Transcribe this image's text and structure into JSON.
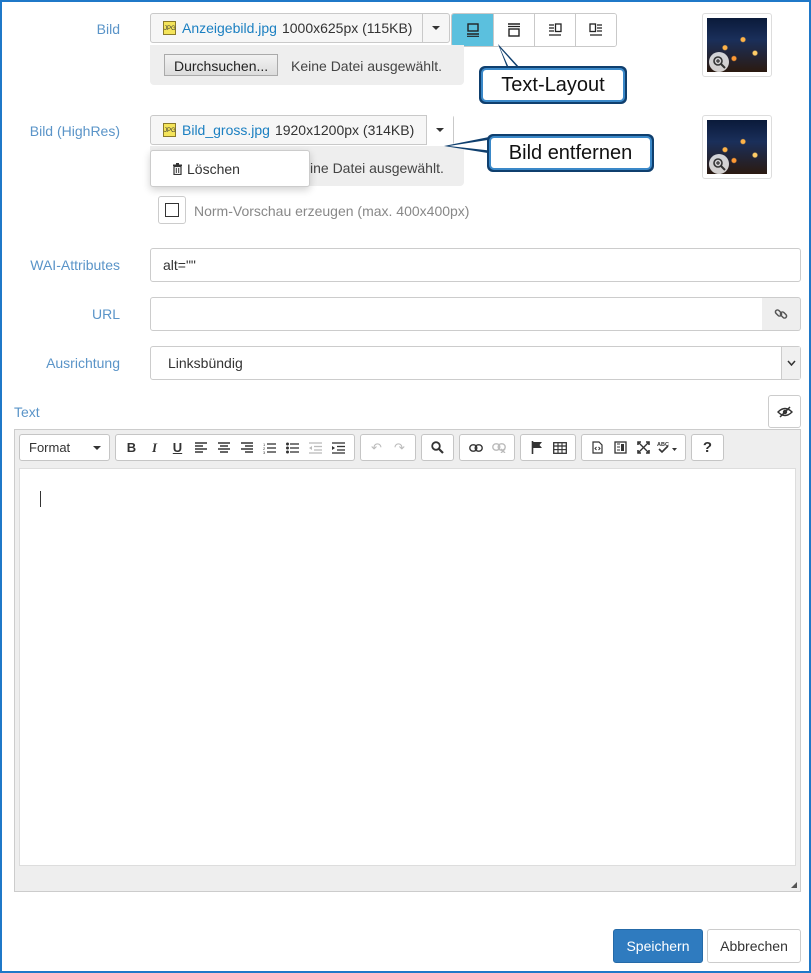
{
  "bild": {
    "label": "Bild",
    "file_name": "Anzeigebild.jpg",
    "file_info": "1000x625px (115KB)",
    "browse_label": "Durchsuchen...",
    "no_file": "Keine Datei ausgewählt.",
    "layout_options": [
      "text-layout-1-icon",
      "text-layout-2-icon",
      "text-layout-3-icon",
      "text-layout-4-icon"
    ],
    "selected_layout": 0
  },
  "callouts": {
    "text_layout": "Text-Layout",
    "bild_entfernen": "Bild entfernen"
  },
  "bild_highres": {
    "label": "Bild (HighRes)",
    "file_name": "Bild_gross.jpg",
    "file_info": "1920x1200px (314KB)",
    "no_file_partial": "ine Datei ausgewählt.",
    "dropdown_delete": "Löschen"
  },
  "norm_preview": {
    "label": "Norm-Vorschau erzeugen (max. 400x400px)",
    "checked": false
  },
  "wai": {
    "label": "WAI-Attributes",
    "value": "alt=\"\""
  },
  "url": {
    "label": "URL",
    "value": ""
  },
  "ausrichtung": {
    "label": "Ausrichtung",
    "value": "Linksbündig"
  },
  "text": {
    "label": "Text",
    "format_label": "Format",
    "toolbar_groups": [
      [
        "bold",
        "italic",
        "underline",
        "align-left",
        "align-center",
        "align-right",
        "ordered-list",
        "unordered-list",
        "outdent",
        "indent"
      ],
      [
        "undo",
        "redo"
      ],
      [
        "search"
      ],
      [
        "link",
        "unlink"
      ],
      [
        "flag",
        "table"
      ],
      [
        "source",
        "template",
        "fullscreen",
        "spellcheck"
      ],
      [
        "help"
      ]
    ]
  },
  "buttons": {
    "save": "Speichern",
    "cancel": "Abbrechen"
  },
  "colors": {
    "accent": "#2f7bbf",
    "label": "#5a94c8",
    "layout_active": "#5bc0de",
    "frame": "#1f78c8"
  }
}
